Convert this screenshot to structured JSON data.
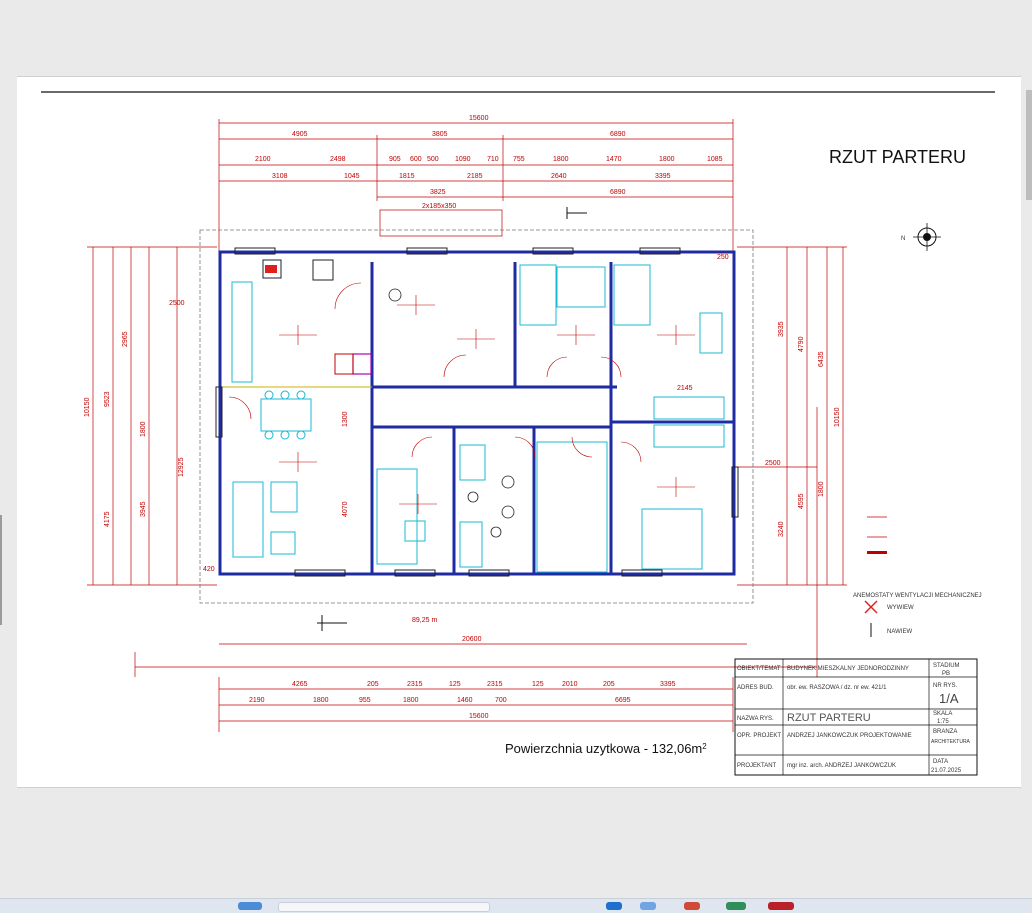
{
  "drawing": {
    "title": "RZUT PARTERU",
    "area_label": "Powierzchnia uzytkowa - 132,06m",
    "area_sup": "2",
    "top_dims": {
      "total": "15600",
      "row1": [
        "4905",
        "3805",
        "6890"
      ],
      "row2": [
        "2100",
        "2498",
        "905",
        "600",
        "500",
        "1090",
        "710",
        "755",
        "1800",
        "1470",
        "1800",
        "1085"
      ],
      "row3": [
        "3108",
        "1045",
        "1815",
        "2185",
        "2640",
        "3395"
      ],
      "row4": [
        "3825",
        "6890"
      ]
    },
    "bottom_dims": {
      "row1": [
        "4265",
        "205",
        "2315",
        "125",
        "2315",
        "125",
        "2010",
        "205",
        "3395"
      ],
      "row2": [
        "2190",
        "1800",
        "955",
        "1800",
        "1460",
        "700",
        "6695"
      ],
      "total": "15600",
      "overall": "20600"
    },
    "left_dims": [
      "10150",
      "9523",
      "12925",
      "4175",
      "2965",
      "3945",
      "4070",
      "1800",
      "2500",
      "1300"
    ],
    "right_dims": [
      "3935",
      "4790",
      "6435",
      "10150",
      "4595",
      "3240",
      "2500",
      "1800",
      "2145"
    ],
    "misc_labels": [
      "2x185x350",
      "89,25 m",
      "420",
      "250"
    ],
    "compass_label": "N"
  },
  "title_block": {
    "rows": [
      {
        "label": "OBIEKT/TEMAT",
        "value": "BUDYNEK MIESZKALNY JEDNORODZINNY",
        "side_label": "STADIUM",
        "side_value": "PB"
      },
      {
        "label": "ADRES BUD.",
        "value": "obr. ew. RASZOWA / dz. nr ew. 421/1",
        "side_label": "NR RYS.",
        "side_value": "1/A"
      },
      {
        "label": "NAZWA RYS.",
        "value": "RZUT PARTERU",
        "side_label": "SKALA",
        "side_value": "1:75"
      },
      {
        "label": "OPR. PROJEKT",
        "value": "ANDRZEJ JANKOWCZUK PROJEKTOWANIE",
        "side_label": "BRANZA",
        "side_value": "ARCHITEKTURA"
      },
      {
        "label": "PROJEKTANT",
        "value": "mgr inz. arch. ANDRZEJ JANKOWCZUK",
        "side_label": "DATA",
        "side_value": "21.07.2025"
      }
    ]
  },
  "legend": {
    "items": [
      "WYWIEW",
      "NAWIEW"
    ],
    "heading": "ANEMOSTATY WENTYLACJI MECHANICZNEJ"
  },
  "colors": {
    "walls": "#1f2ba0",
    "dimension": "#c00000",
    "furniture": "#19b8d6",
    "accent": "#e02020"
  }
}
